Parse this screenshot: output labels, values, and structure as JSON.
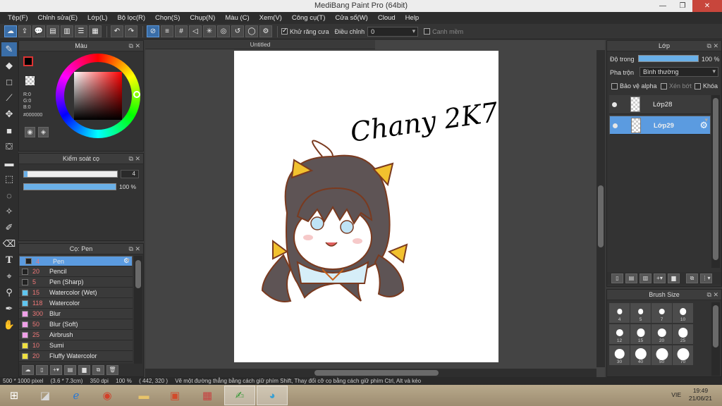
{
  "window": {
    "title": "MediBang Paint Pro (64bit)",
    "minimize": "—",
    "maximize": "❐",
    "close": "✕"
  },
  "menu": [
    "Tệp(F)",
    "Chỉnh sửa(E)",
    "Lớp(L)",
    "Bộ lọc(R)",
    "Chọn(S)",
    "Chụp(N)",
    "Màu (C)",
    "Xem(V)",
    "Công cụ(T)",
    "Cửa sổ(W)",
    "Cloud",
    "Help"
  ],
  "toolbar": {
    "antialias_label": "Khử răng cưa",
    "antialias_checked": true,
    "correction_label": "Điều chỉnh",
    "correction_value": "0",
    "edge_label": "Canh mềm",
    "edge_checked": false
  },
  "color_panel": {
    "title": "Màu",
    "r": "R:0",
    "g": "G:0",
    "b": "B:0",
    "hex": "#000000",
    "foreground": "#000000"
  },
  "brush_control": {
    "title": "Kiểm soát cọ",
    "size": "4",
    "size_fraction": 0.04,
    "opacity": "100 %",
    "opacity_fraction": 1.0
  },
  "brush_list": {
    "title": "Cọ: Pen",
    "items": [
      {
        "size": "4",
        "name": "Pen",
        "color": "#222222",
        "selected": true
      },
      {
        "size": "20",
        "name": "Pencil",
        "color": "#222222",
        "selected": false
      },
      {
        "size": "5",
        "name": "Pen (Sharp)",
        "color": "#222222",
        "selected": false
      },
      {
        "size": "15",
        "name": "Watercolor (Wet)",
        "color": "#5fc6f0",
        "selected": false
      },
      {
        "size": "118",
        "name": "Watercolor",
        "color": "#5fc6f0",
        "selected": false
      },
      {
        "size": "300",
        "name": "Blur",
        "color": "#f0a0e8",
        "selected": false
      },
      {
        "size": "50",
        "name": "Blur (Soft)",
        "color": "#f0a0e8",
        "selected": false
      },
      {
        "size": "25",
        "name": "Airbrush",
        "color": "#f0a0e8",
        "selected": false
      },
      {
        "size": "10",
        "name": "Sumi",
        "color": "#f0e040",
        "selected": false
      },
      {
        "size": "20",
        "name": "Fluffy Watercolor",
        "color": "#f0e040",
        "selected": false
      }
    ]
  },
  "canvas": {
    "tab": "Untitled",
    "signature_text": "Chany 2K7"
  },
  "layer_panel": {
    "title": "Lớp",
    "opacity_label": "Độ trong",
    "opacity_value": "100 %",
    "opacity_fraction": 1.0,
    "blend_label": "Pha trộn",
    "blend_value": "Bình thường",
    "protect_alpha": "Bảo vệ alpha",
    "clipping": "Xén bớt",
    "lock": "Khóa",
    "layers": [
      {
        "name": "Lớp28",
        "selected": false
      },
      {
        "name": "Lớp29",
        "selected": true
      }
    ]
  },
  "brush_size_panel": {
    "title": "Brush Size",
    "sizes": [
      "4",
      "5",
      "7",
      "10",
      "12",
      "15",
      "20",
      "25",
      "30",
      "40",
      "50",
      "70"
    ]
  },
  "status": {
    "size": "500 * 1000 pixel",
    "cm": "(3.6 * 7.3cm)",
    "dpi": "350 dpi",
    "zoom": "100 %",
    "coords": "( 442, 320 )",
    "hint": "Vẽ một đường thẳng bằng cách giữ phím Shift, Thay đổi cỡ cọ bằng cách giữ phím Ctrl, Alt và kéo"
  },
  "taskbar": {
    "lang": "VIE",
    "time": "19:49",
    "date": "21/06/21"
  }
}
